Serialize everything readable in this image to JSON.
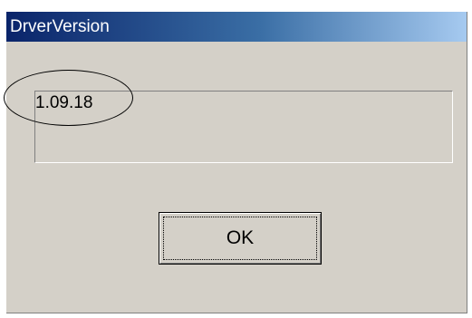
{
  "window": {
    "title": "DrverVersion"
  },
  "version_box": {
    "value": "1.09.18"
  },
  "ok_button": {
    "label": "OK"
  },
  "colors": {
    "title_gradient_start": "#0a246a",
    "title_gradient_end": "#a6caf0",
    "dialog_face": "#d4d0c8",
    "annotation_circle": "#000000"
  }
}
